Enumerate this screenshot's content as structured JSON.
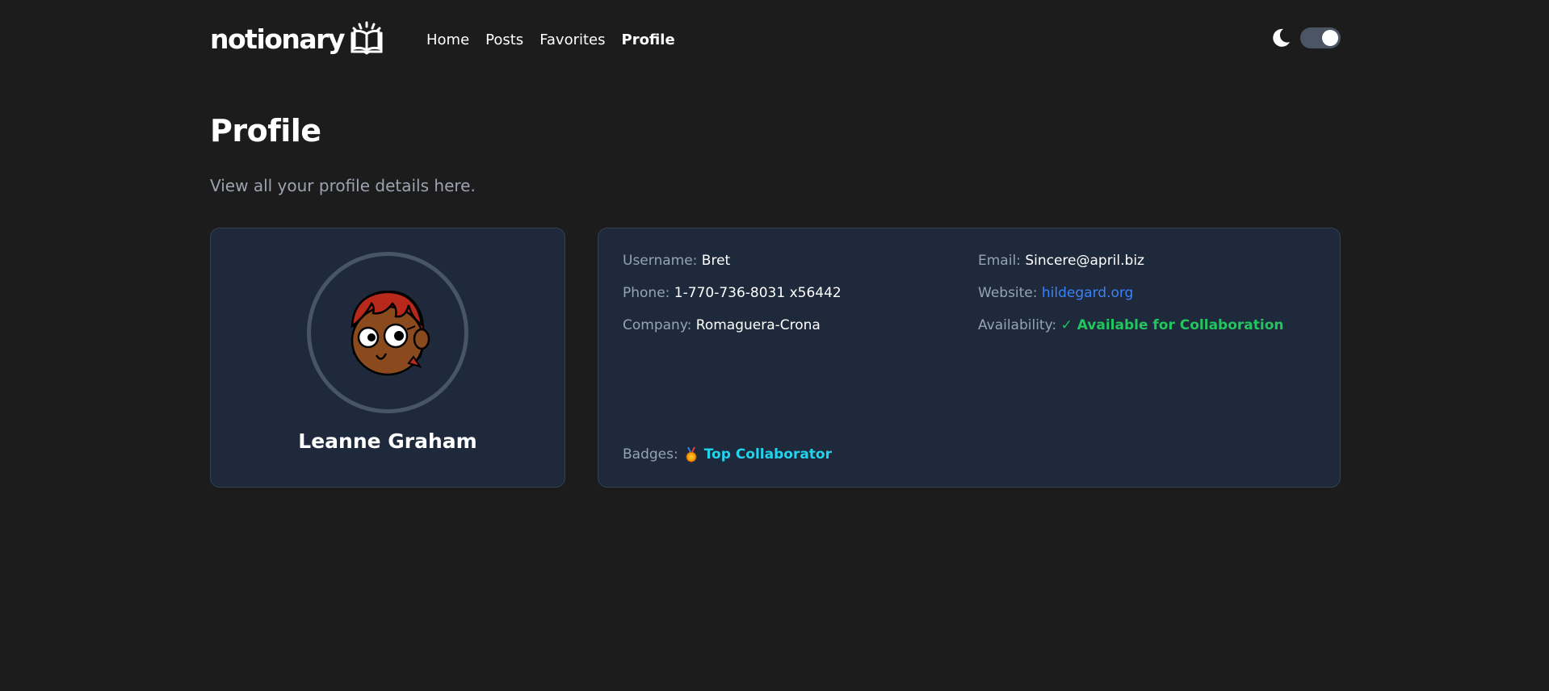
{
  "header": {
    "logo_text": "notionary",
    "nav": [
      {
        "label": "Home",
        "active": false
      },
      {
        "label": "Posts",
        "active": false
      },
      {
        "label": "Favorites",
        "active": false
      },
      {
        "label": "Profile",
        "active": true
      }
    ],
    "theme_icon": "moon-icon",
    "theme_toggle_on": true
  },
  "page": {
    "title": "Profile",
    "subtitle": "View all your profile details here."
  },
  "profile": {
    "name": "Leanne Graham",
    "avatar_icon": "cartoon-avatar",
    "fields": {
      "username_label": "Username:",
      "username": "Bret",
      "email_label": "Email:",
      "email": "Sincere@april.biz",
      "phone_label": "Phone:",
      "phone": "1-770-736-8031 x56442",
      "website_label": "Website:",
      "website": "hildegard.org",
      "company_label": "Company:",
      "company": "Romaguera-Crona",
      "availability_label": "Availability:",
      "availability": "✓ Available for Collaboration"
    },
    "badges_label": "Badges:",
    "badge_icon": "medal-icon",
    "badge": "Top Collaborator"
  },
  "colors": {
    "background": "#1c1c1c",
    "card": "#1e293b",
    "link": "#3b82f6",
    "available": "#22c55e",
    "badge": "#22d3ee"
  }
}
